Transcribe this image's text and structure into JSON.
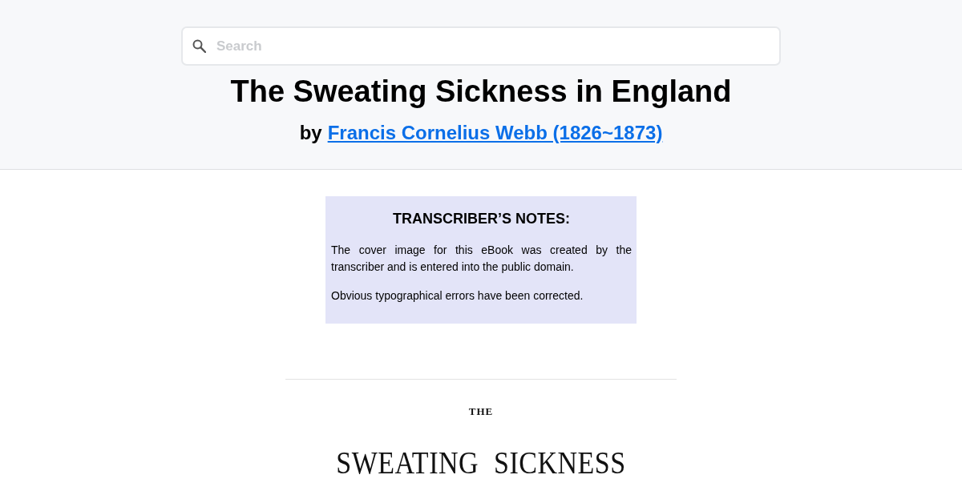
{
  "search": {
    "placeholder": "Search"
  },
  "header": {
    "title": "The Sweating Sickness in England",
    "byline_prefix": "by",
    "author_link": "Francis Cornelius Webb (1826~1873)"
  },
  "transcriber_notes": {
    "heading": "TRANSCRIBER’S NOTES:",
    "paragraphs": [
      "The cover image for this eBook was created by the transcriber and is entered into the public domain.",
      "Obvious typographical errors have been corrected."
    ]
  },
  "title_page": {
    "lines": [
      {
        "kind": "small",
        "text": "THE"
      },
      {
        "kind": "large",
        "text": "SWEATING SICKNESS"
      }
    ]
  }
}
